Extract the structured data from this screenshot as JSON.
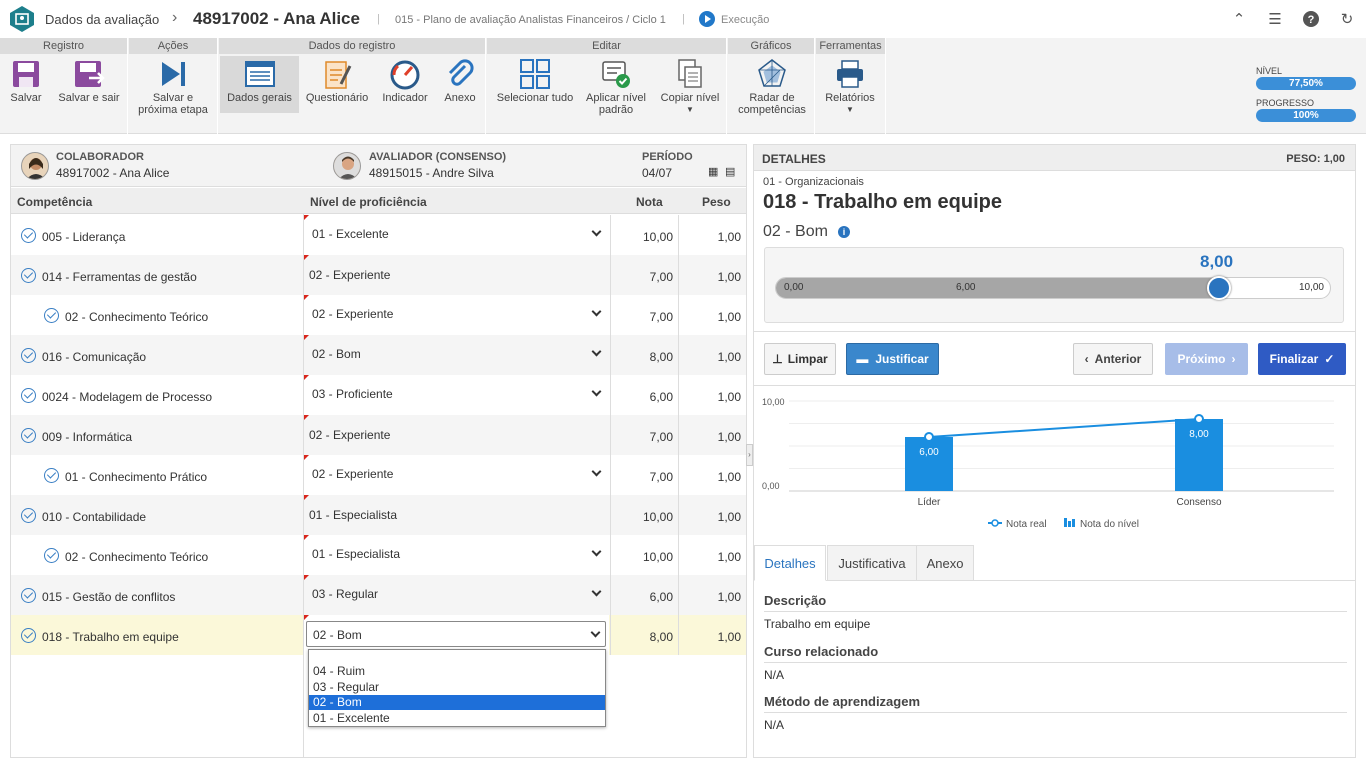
{
  "titlebar": {
    "section": "Dados da avaliação",
    "title": "48917002 - Ana Alice",
    "plan": "015 - Plano de avaliação Analistas Financeiros / Ciclo 1",
    "status": "Execução"
  },
  "ribbon": {
    "groups": [
      "Registro",
      "Ações",
      "Dados do registro",
      "Editar",
      "Gráficos",
      "Ferramentas"
    ],
    "buttons": {
      "salvar": "Salvar",
      "salvar_sair": "Salvar e sair",
      "salvar_prox_1": "Salvar e",
      "salvar_prox_2": "próxima etapa",
      "dados_gerais": "Dados gerais",
      "questionario": "Questionário",
      "indicador": "Indicador",
      "anexo": "Anexo",
      "selecionar": "Selecionar tudo",
      "aplicar_1": "Aplicar nível",
      "aplicar_2": "padrão",
      "copiar": "Copiar nível",
      "radar_1": "Radar de",
      "radar_2": "competências",
      "relatorios": "Relatórios"
    },
    "nivel_label": "NÍVEL",
    "nivel_value": "77,50%",
    "nivel_fraction": 0.775,
    "progresso_label": "PROGRESSO",
    "progresso_value": "100%",
    "progresso_fraction": 1.0
  },
  "info": {
    "colaborador_label": "COLABORADOR",
    "colaborador": "48917002 - Ana Alice",
    "avaliador_label": "AVALIADOR (CONSENSO)",
    "avaliador": "48915015 - Andre Silva",
    "periodo_label": "PERÍODO",
    "periodo": "04/07"
  },
  "table": {
    "headers": [
      "Competência",
      "Nível de proficiência",
      "Nota",
      "Peso"
    ],
    "rows": [
      {
        "name": "005 - Liderança",
        "level": "01 - Excelente",
        "nota": "10,00",
        "peso": "1,00"
      },
      {
        "name": "014 - Ferramentas de gestão",
        "level": "02 - Experiente",
        "nota": "7,00",
        "peso": "1,00"
      },
      {
        "name": "02 - Conhecimento Teórico",
        "level": "02 - Experiente",
        "nota": "7,00",
        "peso": "1,00"
      },
      {
        "name": "016 - Comunicação",
        "level": "02 - Bom",
        "nota": "8,00",
        "peso": "1,00"
      },
      {
        "name": "0024 - Modelagem de Processo",
        "level": "03 - Proficiente",
        "nota": "6,00",
        "peso": "1,00"
      },
      {
        "name": "009 - Informática",
        "level": "02 - Experiente",
        "nota": "7,00",
        "peso": "1,00"
      },
      {
        "name": "01 - Conhecimento Prático",
        "level": "02 - Experiente",
        "nota": "7,00",
        "peso": "1,00"
      },
      {
        "name": "010 - Contabilidade",
        "level": "01 - Especialista",
        "nota": "10,00",
        "peso": "1,00"
      },
      {
        "name": "02 - Conhecimento Teórico",
        "level": "01 - Especialista",
        "nota": "10,00",
        "peso": "1,00"
      },
      {
        "name": "015 - Gestão de conflitos",
        "level": "03 - Regular",
        "nota": "6,00",
        "peso": "1,00"
      },
      {
        "name": "018 - Trabalho em equipe",
        "level": "02 - Bom",
        "nota": "8,00",
        "peso": "1,00"
      }
    ],
    "dropdown_options": [
      "04 - Ruim",
      "03 - Regular",
      "02 - Bom",
      "01 - Excelente"
    ]
  },
  "details": {
    "header": "DETALHES",
    "peso": "PESO: 1,00",
    "category": "01 - Organizacionais",
    "title": "018 - Trabalho em equipe",
    "level": "02 - Bom",
    "slider_value": "8,00",
    "slider_fraction": 0.8,
    "slider_min": "0,00",
    "slider_mid": "6,00",
    "slider_max": "10,00",
    "btn_limpar": "Limpar",
    "btn_justificar": "Justificar",
    "btn_anterior": "Anterior",
    "btn_proximo": "Próximo",
    "btn_finalizar": "Finalizar",
    "tabs": [
      "Detalhes",
      "Justificativa",
      "Anexo"
    ],
    "descricao_label": "Descrição",
    "descricao": "Trabalho em equipe",
    "curso_label": "Curso relacionado",
    "curso": "N/A",
    "metodo_label": "Método de aprendizagem",
    "metodo": "N/A"
  },
  "chart_data": {
    "type": "bar",
    "categories": [
      "Líder",
      "Consenso"
    ],
    "series": [
      {
        "name": "Nota do nível",
        "values": [
          6.0,
          8.0
        ]
      },
      {
        "name": "Nota real",
        "values": [
          6.0,
          8.0
        ]
      }
    ],
    "data_labels": [
      "6,00",
      "8,00"
    ],
    "ytick_labels": [
      "10,00",
      "0,00"
    ],
    "ylim": [
      0,
      10
    ],
    "legend": [
      "Nota real",
      "Nota do nível"
    ],
    "legend_position": "bottom",
    "bar_color": "#1a8ee0",
    "line_color": "#1a8ee0"
  }
}
